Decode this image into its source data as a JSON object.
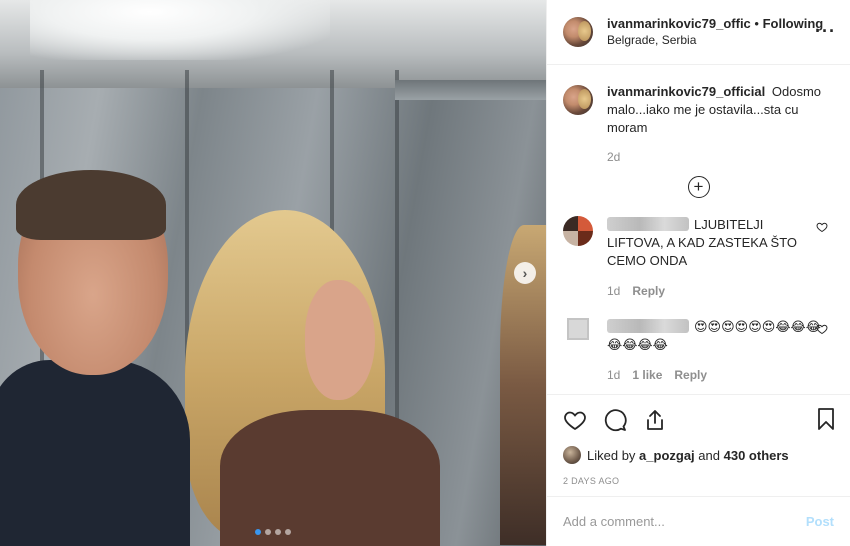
{
  "header": {
    "username": "ivanmarinkovic79_offic",
    "separator": " • ",
    "follow_status": "Following",
    "location": "Belgrade, Serbia",
    "more_icon": "more-horizontal-icon"
  },
  "caption": {
    "username": "ivanmarinkovic79_official",
    "text": "Odosmo malo...iako me je ostavila...sta cu moram",
    "time": "2d"
  },
  "load_more_icon": "plus-circle-icon",
  "comments": [
    {
      "username_hidden": true,
      "text": "LJUBITELJI LIFTOVA, A KAD ZASTEKA ŠTO CEMO ONDA",
      "time": "1d",
      "likes": "",
      "reply_label": "Reply"
    },
    {
      "username_hidden": true,
      "text": "😍😍😍😍😍😍😂😂😂😂😂😂😂",
      "time": "1d",
      "likes": "1 like",
      "reply_label": "Reply"
    }
  ],
  "actions": {
    "like_icon": "heart-icon",
    "comment_icon": "comment-icon",
    "share_icon": "share-icon",
    "save_icon": "bookmark-icon"
  },
  "likes": {
    "prefix": "Liked by ",
    "user": "a_pozgaj",
    "middle": " and ",
    "others": "430 others"
  },
  "date": "2 DAYS AGO",
  "add_comment": {
    "placeholder": "Add a comment...",
    "post_label": "Post"
  },
  "carousel": {
    "total_slides": 4,
    "active_slide": 1
  },
  "colors": {
    "accent": "#3897f0",
    "post_disabled": "#b2dffc",
    "secondary_text": "#8e8e8e"
  }
}
